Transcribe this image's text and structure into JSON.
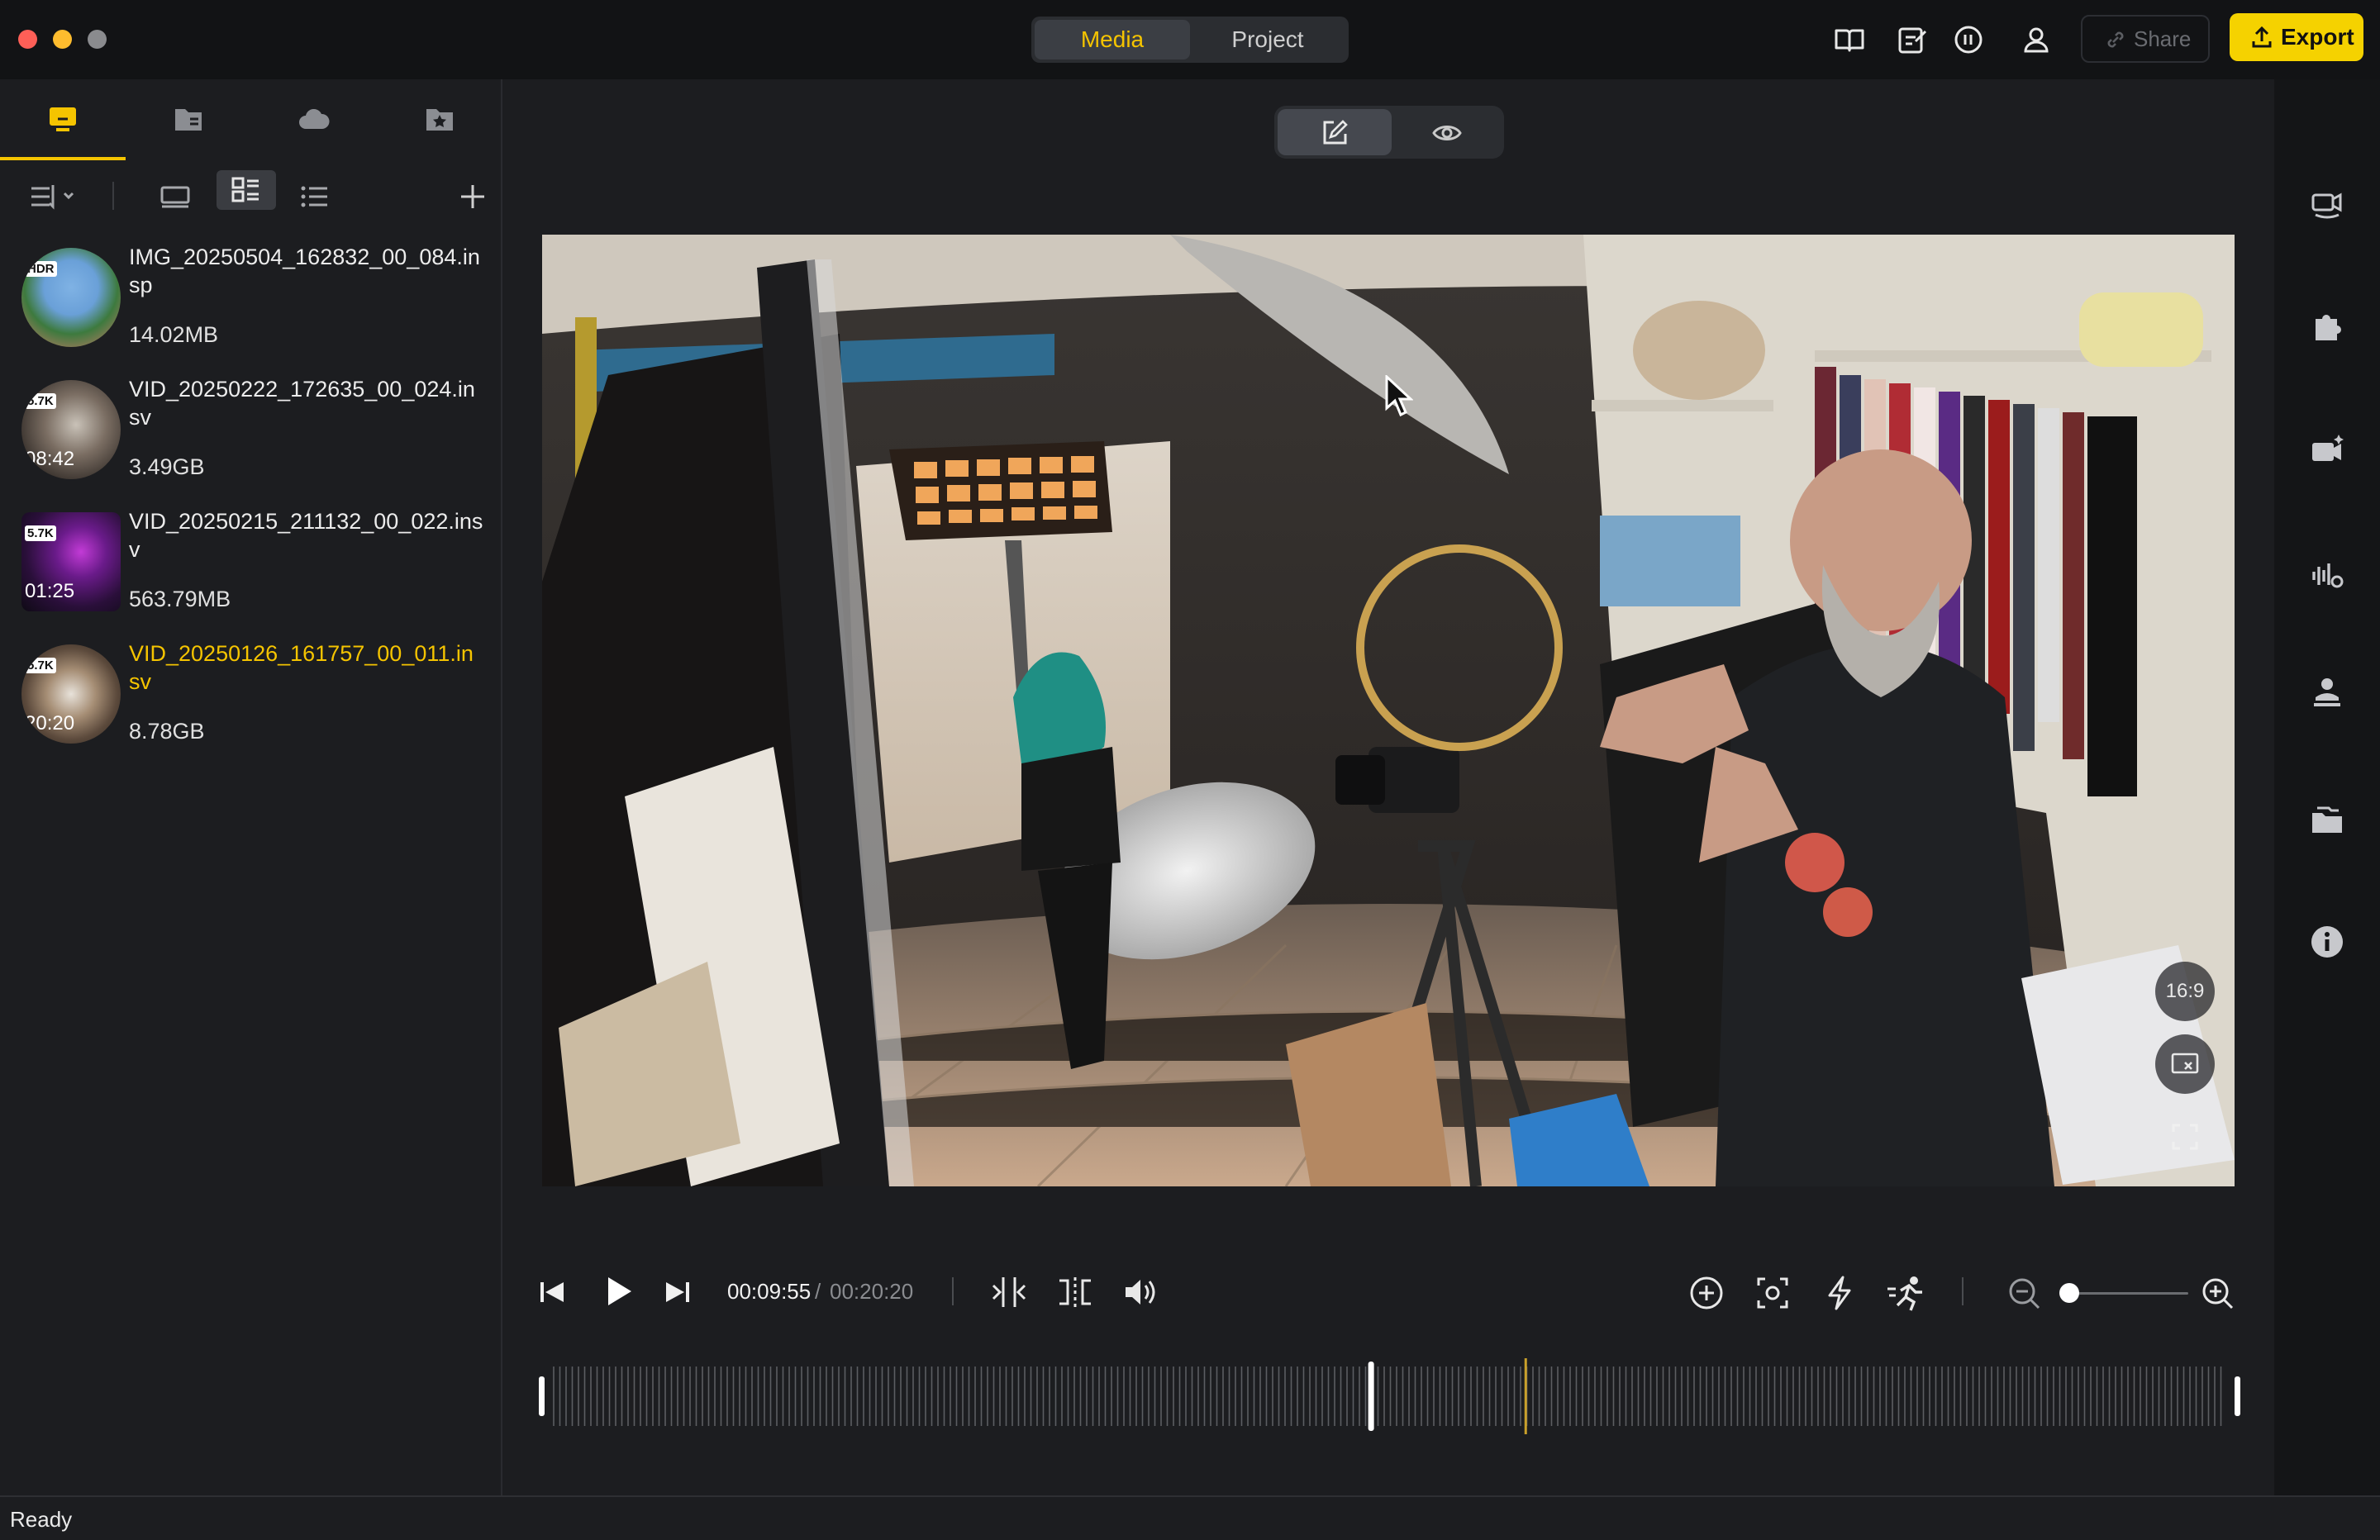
{
  "titlebar": {
    "tabs": [
      {
        "label": "Media",
        "active": true
      },
      {
        "label": "Project",
        "active": false
      }
    ],
    "share_label": "Share",
    "export_label": "Export",
    "accent_color": "#f5c400"
  },
  "sidebar": {
    "tabs": [
      "local-media-icon",
      "folder-icon",
      "cloud-icon",
      "favorites-icon"
    ],
    "toolbar": [
      "sort-icon",
      "large-thumb-view-icon",
      "grid-view-icon",
      "list-view-icon",
      "add-icon"
    ],
    "items": [
      {
        "name": "IMG_20250504_162832_00_084.insp",
        "size": "14.02MB",
        "badge": "HDR",
        "duration": "",
        "selected": false
      },
      {
        "name": "VID_20250222_172635_00_024.insv",
        "size": "3.49GB",
        "badge": "5.7K",
        "duration": "08:42",
        "selected": false
      },
      {
        "name": "VID_20250215_211132_00_022.insv",
        "size": "563.79MB",
        "badge": "5.7K",
        "duration": "01:25",
        "selected": false
      },
      {
        "name": "VID_20250126_161757_00_011.insv",
        "size": "8.78GB",
        "badge": "5.7K",
        "duration": "20:20",
        "selected": true
      }
    ]
  },
  "preview": {
    "aspect_label": "16:9"
  },
  "player": {
    "current_time": "00:09:55",
    "separator": "/",
    "total_time": "00:20:20",
    "playhead_progress": 0.489,
    "marker_progress": 0.581,
    "zoom_level": 0.0
  },
  "status": {
    "text": "Ready"
  }
}
